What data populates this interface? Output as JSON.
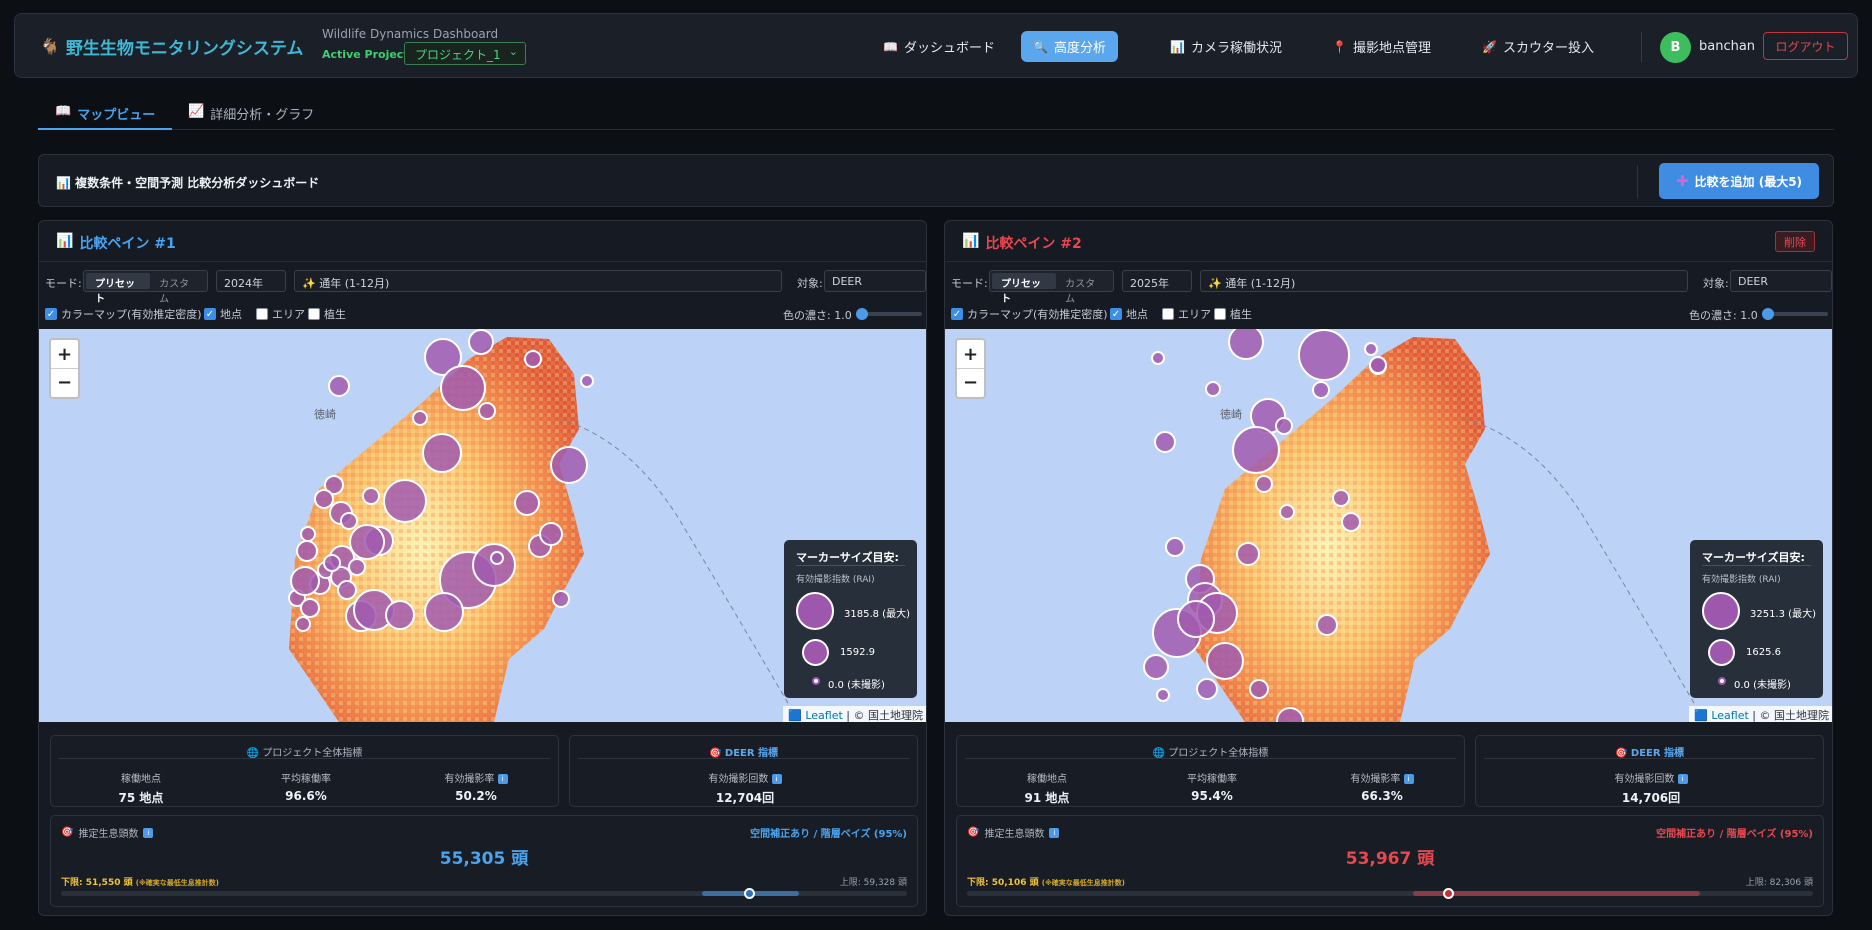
{
  "app": {
    "title": "野生生物モニタリングシステム",
    "subtitle": "Wildlife Dynamics Dashboard",
    "project_label": "Active Project:",
    "project_value": "プロジェクト_1"
  },
  "nav": [
    {
      "icon": "📖",
      "label": "ダッシュボード"
    },
    {
      "icon": "🔍",
      "label": "高度分析"
    },
    {
      "icon": "📊",
      "label": "カメラ稼働状況"
    },
    {
      "icon": "📍",
      "label": "撮影地点管理"
    },
    {
      "icon": "🚀",
      "label": "スカウター投入"
    }
  ],
  "user": {
    "initial": "B",
    "name": "banchan",
    "logout": "ログアウト"
  },
  "tabs": [
    {
      "icon": "📖",
      "label": "マップビュー"
    },
    {
      "icon": "📈",
      "label": "詳細分析・グラフ"
    }
  ],
  "header": {
    "title": "複数条件・空間予測 比較分析ダッシュボード",
    "add_button": "比較を追加 (最大5)"
  },
  "common": {
    "mode_label": "モード:",
    "preset": "プリセット",
    "custom": "カスタム",
    "target_label": "対象:",
    "layer_colormap": "カラーマップ(有効推定密度)",
    "layer_points": "地点",
    "layer_area": "エリア",
    "layer_vegetation": "植生",
    "intensity_label": "色の濃さ: 1.0",
    "legend_title": "マーカーサイズ目安:",
    "legend_sub": "有効撮影指数 (RAI)",
    "legend_zero": "0.0 (未撮影)",
    "attrib_leaflet": "Leaflet",
    "attrib_rest": "| © 国土地理院",
    "project_metrics_title": "プロジェクト全体指標",
    "metric_sites": "稼働地点",
    "metric_uptime": "平均稼働率",
    "metric_rate": "有効撮影率",
    "deer_title": "DEER 指標",
    "deer_count_label": "有効撮影回数",
    "est_label": "推定生息頭数",
    "est_tag": "空間補正あり / 階層ベイズ (95%)",
    "low_note": "(※確実な最低生息推計数)",
    "delete": "削除",
    "map_label": "徳崎"
  },
  "panes": [
    {
      "title": "比較ペイン #1",
      "accent": "#4aa3ee",
      "year": "2024年",
      "period": "通年 (1-12月)",
      "target": "DEER",
      "legend_max": "3185.8 (最大)",
      "legend_mid": "1592.9",
      "sites": "75 地点",
      "uptime": "96.6%",
      "rate": "50.2%",
      "deer_count": "12,704回",
      "estimate": "55,305 頭",
      "low": "下限: 51,550 頭",
      "high": "上限: 59,328 頭",
      "estimate_value": 55305,
      "low_value": 51550,
      "high_value": 59328
    },
    {
      "title": "比較ペイン #2",
      "accent": "#e8474f",
      "year": "2025年",
      "period": "通年 (1-12月)",
      "target": "DEER",
      "legend_max": "3251.3 (最大)",
      "legend_mid": "1625.6",
      "sites": "91 地点",
      "uptime": "95.4%",
      "rate": "66.3%",
      "deer_count": "14,706回",
      "estimate": "53,967 頭",
      "low": "下限: 50,106 頭",
      "high": "上限: 82,306 頭",
      "estimate_value": 53967,
      "low_value": 50106,
      "high_value": 82306
    }
  ]
}
